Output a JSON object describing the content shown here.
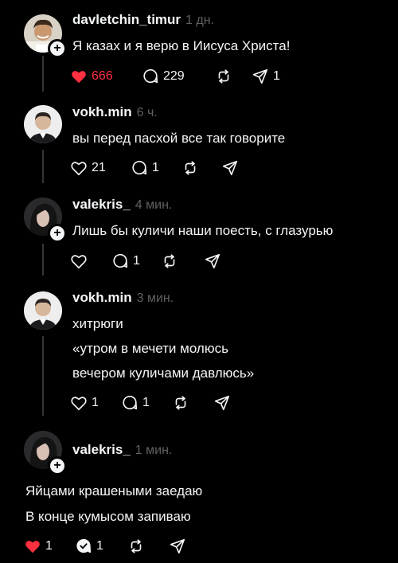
{
  "colors": {
    "background": "#000000",
    "text": "#f3f5f7",
    "muted": "#616161",
    "like_active": "#ff3040",
    "thread_line": "#333638"
  },
  "posts": [
    {
      "username": "davletchin_timur",
      "time": "1 дн.",
      "lines": [
        "Я казах и я верю в Иисуса Христа!"
      ],
      "likes": "666",
      "liked": true,
      "replies": "229",
      "reposts": "",
      "shares": "1"
    },
    {
      "username": "vokh.min",
      "time": "6 ч.",
      "lines": [
        "вы перед пасхой все так говорите"
      ],
      "likes": "21",
      "liked": false,
      "replies": "1",
      "reposts": "",
      "shares": ""
    },
    {
      "username": "valekris_",
      "time": "4 мин.",
      "lines": [
        "Лишь бы куличи наши поесть, с глазурью"
      ],
      "likes": "",
      "liked": false,
      "replies": "1",
      "reposts": "",
      "shares": ""
    },
    {
      "username": "vokh.min",
      "time": "3 мин.",
      "lines": [
        "хитрюги",
        "«утром в мечети молюсь",
        "вечером куличами давлюсь»"
      ],
      "likes": "1",
      "liked": false,
      "replies": "1",
      "reposts": "",
      "shares": ""
    },
    {
      "username": "valekris_",
      "time": "1 мин.",
      "lines": [
        "Яйцами крашеными заедаю",
        "В конце кумысом запиваю"
      ],
      "likes": "1",
      "liked": true,
      "replies": "1",
      "reposts": "",
      "shares": ""
    }
  ],
  "icons": {
    "like": "heart-icon",
    "reply": "comment-icon",
    "repost": "repost-icon",
    "share": "share-icon",
    "follow": "plus-icon"
  }
}
